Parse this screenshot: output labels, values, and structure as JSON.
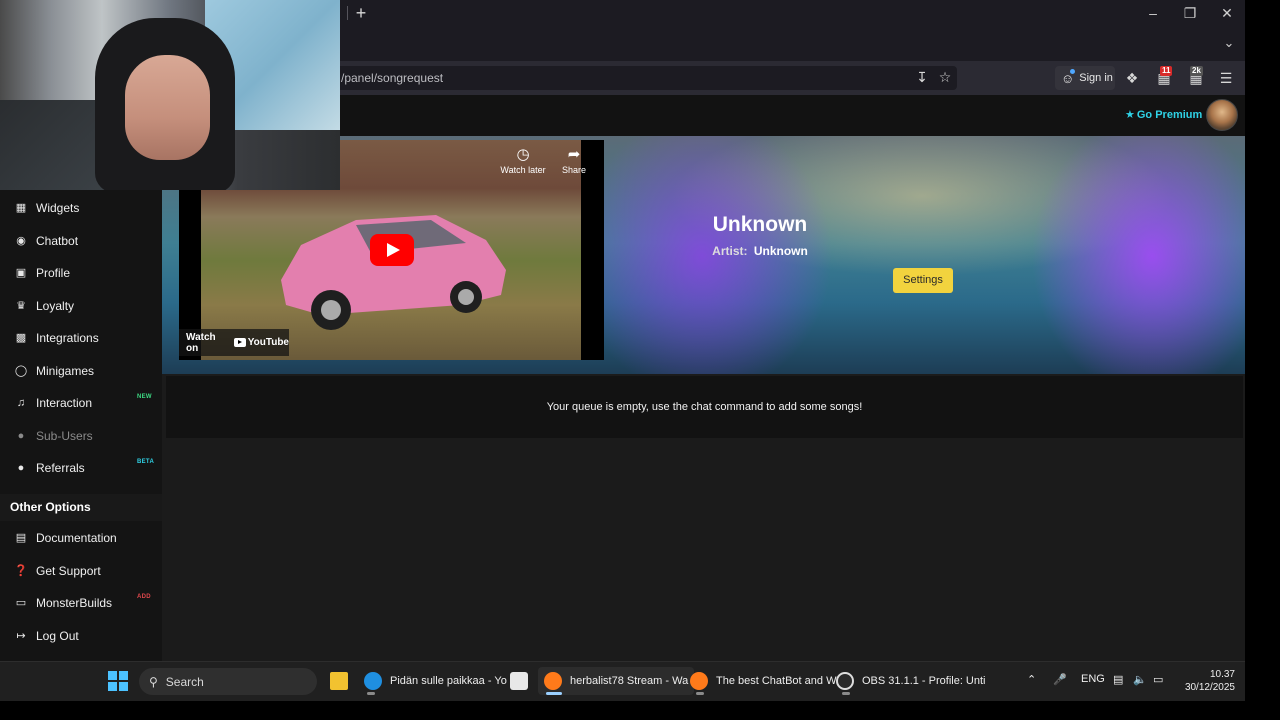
{
  "browser": {
    "url": "/panel/songrequest",
    "new_tab": "+",
    "sign_in": "Sign in",
    "ext_badge_1": "11",
    "ext_badge_2": "2k"
  },
  "header": {
    "premium_label": "Go Premium"
  },
  "sidebar": {
    "items": [
      {
        "label": "Widgets",
        "icon": "widgets-icon"
      },
      {
        "label": "Chatbot",
        "icon": "robot-icon"
      },
      {
        "label": "Profile",
        "icon": "id-card-icon"
      },
      {
        "label": "Loyalty",
        "icon": "trophy-icon"
      },
      {
        "label": "Integrations",
        "icon": "plug-icon"
      },
      {
        "label": "Minigames",
        "icon": "gamepad-icon"
      },
      {
        "label": "Interaction",
        "icon": "music-note-icon",
        "tag": "NEW"
      },
      {
        "label": "Sub-Users",
        "icon": "users-icon"
      },
      {
        "label": "Referrals",
        "icon": "referral-icon",
        "tag": "BETA"
      }
    ],
    "other_heading": "Other Options",
    "other_items": [
      {
        "label": "Documentation",
        "icon": "book-icon"
      },
      {
        "label": "Get Support",
        "icon": "question-icon"
      },
      {
        "label": "MonsterBuilds",
        "icon": "laptop-icon",
        "tag": "ADD"
      },
      {
        "label": "Log Out",
        "icon": "logout-icon"
      }
    ]
  },
  "player": {
    "title": "Unknown",
    "artist_label": "Artist:",
    "artist_value": "Unknown",
    "settings_label": "Settings",
    "video": {
      "watch_later": "Watch later",
      "share": "Share",
      "watch_on": "Watch on",
      "youtube": "YouTube"
    }
  },
  "queue": {
    "empty_message": "Your queue is empty, use the chat command to add some songs!"
  },
  "taskbar": {
    "search": "Search",
    "apps": [
      {
        "label": "Pidän sulle paikkaa - Yo",
        "color": "#1f8fe0"
      },
      {
        "label": "herbalist78 Stream - Wa",
        "color": "#ff7a1a"
      },
      {
        "label": "The best ChatBot and W",
        "color": "#ff7a1a"
      },
      {
        "label": "OBS 31.1.1 - Profile: Unti",
        "color": "#dddddd"
      }
    ],
    "lang": "ENG",
    "time": "10.37",
    "date": "30/12/2025"
  },
  "colors": {
    "accent_premium": "#2fd2e6",
    "settings_button": "#f2d33e",
    "tag_new": "#3ddc84",
    "tag_beta": "#2fd2e6",
    "tag_add": "#e0474c"
  }
}
